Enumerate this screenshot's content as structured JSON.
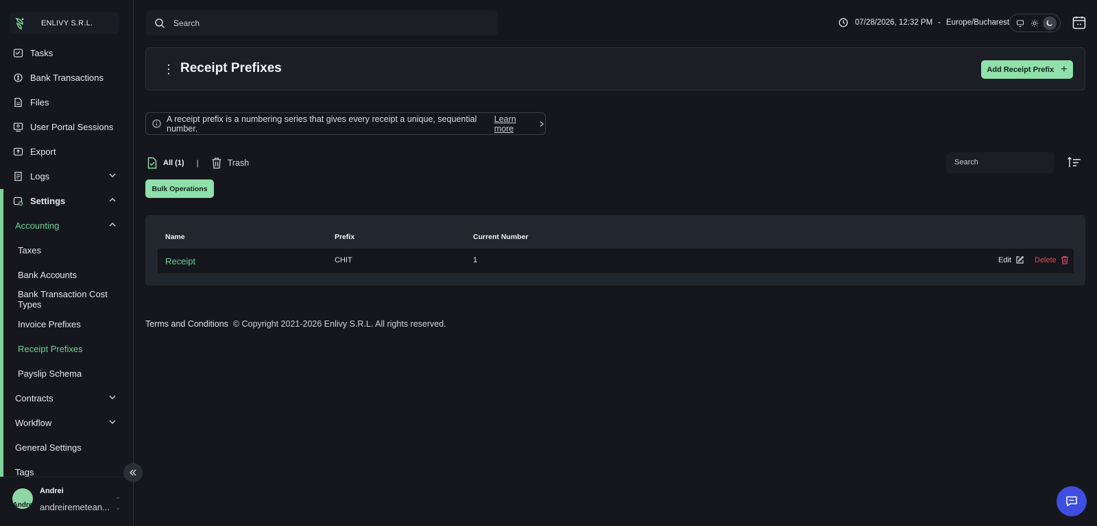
{
  "org": {
    "name": "ENLIVY S.R.L.",
    "logo_icon": "enlivy-logo-icon"
  },
  "sidebar": {
    "items": [
      {
        "label": "Tasks",
        "icon": "tasks-icon"
      },
      {
        "label": "Bank Transactions",
        "icon": "bank-transactions-icon"
      },
      {
        "label": "Files",
        "icon": "file-icon"
      },
      {
        "label": "User Portal Sessions",
        "icon": "user-portal-icon"
      },
      {
        "label": "Export",
        "icon": "export-icon"
      },
      {
        "label": "Logs",
        "icon": "logs-icon",
        "expanded": false
      },
      {
        "label": "Settings",
        "icon": "settings-icon",
        "expanded": true
      }
    ],
    "accounting": {
      "label": "Accounting",
      "expanded": true
    },
    "accounting_items": [
      "Taxes",
      "Bank Accounts",
      "Bank Transaction Cost Types",
      "Invoice Prefixes",
      "Receipt Prefixes",
      "Payslip Schema"
    ],
    "active_item": "Receipt Prefixes",
    "settings_items": [
      {
        "label": "Contracts",
        "expanded": false
      },
      {
        "label": "Workflow",
        "expanded": false
      },
      {
        "label": "General Settings"
      },
      {
        "label": "Tags"
      }
    ]
  },
  "user": {
    "name": "Andrei",
    "email": "andreiremetean...",
    "avatar_text": "Andre"
  },
  "topbar": {
    "search_placeholder": "Search",
    "date": "07/28/2026, 12:32 PM",
    "separator": "-",
    "timezone": "Europe/Bucharest",
    "theme_modes": [
      "monitor-icon",
      "sun-icon",
      "moon-icon"
    ],
    "active_theme": "dark"
  },
  "page": {
    "title": "Receipt Prefixes",
    "add_button": "Add Receipt Prefix",
    "info_text": "A receipt prefix is a numbering series that gives every receipt a unique, sequential number.",
    "learn_more": "Learn more"
  },
  "filters": {
    "all_label": "All (1)",
    "pipe": "|",
    "trash_label": "Trash",
    "search_placeholder": "Search",
    "bulk_label": "Bulk Operations"
  },
  "table": {
    "columns": [
      "Name",
      "Prefix",
      "Current Number"
    ],
    "rows": [
      {
        "name": "Receipt",
        "prefix": "CHIT",
        "current_number": "1"
      }
    ],
    "edit_label": "Edit",
    "delete_label": "Delete"
  },
  "footer": {
    "terms": "Terms and Conditions",
    "copyright": "© Copyright 2021-2026 Enlivy S.R.L. All rights reserved."
  },
  "colors": {
    "accent": "#8fe0aa",
    "active_text": "#6fcf97",
    "danger": "#e0445e",
    "background": "#15171d",
    "chat": "#3d4ee0"
  }
}
